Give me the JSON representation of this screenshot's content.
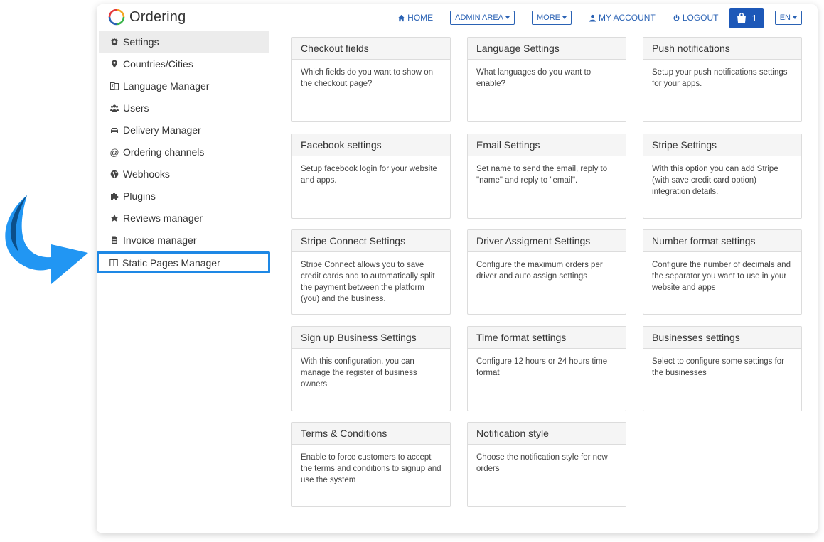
{
  "app": {
    "name": "Ordering"
  },
  "nav": {
    "home": "HOME",
    "admin_area": "ADMIN AREA",
    "more": "MORE",
    "my_account": "MY ACCOUNT",
    "logout": "LOGOUT",
    "cart_count": "1",
    "language": "EN"
  },
  "sidebar": {
    "items": [
      {
        "label": "Settings",
        "icon": "gear-icon"
      },
      {
        "label": "Countries/Cities",
        "icon": "map-pin-icon"
      },
      {
        "label": "Language Manager",
        "icon": "language-icon"
      },
      {
        "label": "Users",
        "icon": "users-icon"
      },
      {
        "label": "Delivery Manager",
        "icon": "car-icon"
      },
      {
        "label": "Ordering channels",
        "icon": "at-icon"
      },
      {
        "label": "Webhooks",
        "icon": "globe-icon"
      },
      {
        "label": "Plugins",
        "icon": "puzzle-icon"
      },
      {
        "label": "Reviews manager",
        "icon": "star-icon"
      },
      {
        "label": "Invoice manager",
        "icon": "file-icon"
      },
      {
        "label": "Static Pages Manager",
        "icon": "columns-icon"
      }
    ]
  },
  "cards": [
    {
      "title": "Checkout fields",
      "desc": "Which fields do you want to show on the checkout page?"
    },
    {
      "title": "Language Settings",
      "desc": "What languages do you want to enable?"
    },
    {
      "title": "Push notifications",
      "desc": "Setup your push notifications settings for your apps."
    },
    {
      "title": "Facebook settings",
      "desc": "Setup facebook login for your website and apps."
    },
    {
      "title": "Email Settings",
      "desc": "Set name to send the email, reply to \"name\" and reply to \"email\"."
    },
    {
      "title": "Stripe Settings",
      "desc": "With this option you can add Stripe (with save credit card option) integration details."
    },
    {
      "title": "Stripe Connect Settings",
      "desc": "Stripe Connect allows you to save credit cards and to automatically split the payment between the platform (you) and the business."
    },
    {
      "title": "Driver Assigment Settings",
      "desc": "Configure the maximum orders per driver and auto assign settings"
    },
    {
      "title": "Number format settings",
      "desc": "Configure the number of decimals and the separator you want to use in your website and apps"
    },
    {
      "title": "Sign up Business Settings",
      "desc": "With this configuration, you can manage the register of business owners"
    },
    {
      "title": "Time format settings",
      "desc": "Configure 12 hours or 24 hours time format"
    },
    {
      "title": "Businesses settings",
      "desc": "Select to configure some settings for the businesses"
    },
    {
      "title": "Terms & Conditions",
      "desc": "Enable to force customers to accept the terms and conditions to signup and use the system"
    },
    {
      "title": "Notification style",
      "desc": "Choose the notification style for new orders"
    }
  ],
  "colors": {
    "accent": "#1d58b8",
    "link": "#2a62b4",
    "highlight": "#1e88e5",
    "arrow_dark": "#0b4f8a",
    "arrow_light": "#2196f3"
  }
}
